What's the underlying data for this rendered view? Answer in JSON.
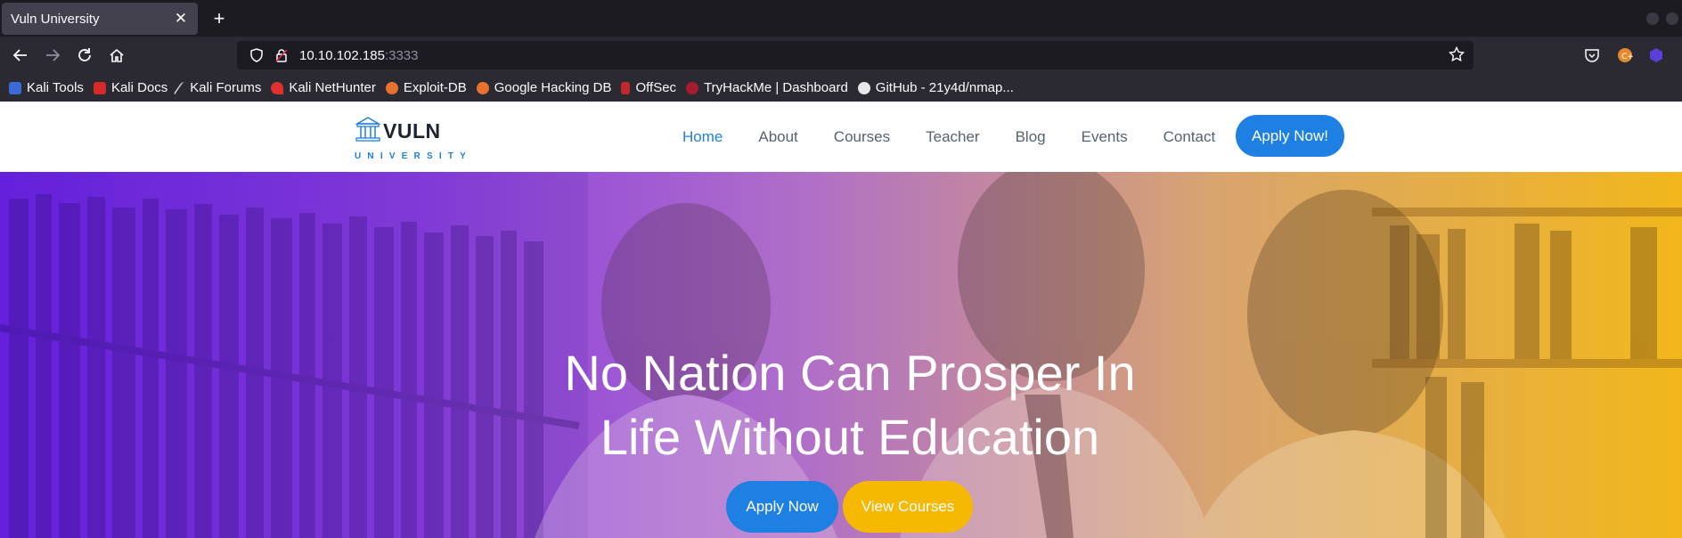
{
  "browser": {
    "tab": {
      "title": "Vuln University",
      "close_glyph": "✕"
    },
    "new_tab_glyph": "+",
    "url": {
      "host": "10.10.102.185",
      "port": ":3333"
    },
    "bookmarks": [
      {
        "label": "Kali Tools",
        "icon": "kali-tools-icon",
        "color": "#3b6bd6"
      },
      {
        "label": "Kali Docs",
        "icon": "kali-docs-icon",
        "color": "#d62b2b"
      },
      {
        "label": "Kali Forums",
        "icon": "kali-forums-icon",
        "color": "#cfcfcf"
      },
      {
        "label": "Kali NetHunter",
        "icon": "kali-nethunter-icon",
        "color": "#e03030"
      },
      {
        "label": "Exploit-DB",
        "icon": "exploit-db-icon",
        "color": "#e6722e"
      },
      {
        "label": "Google Hacking DB",
        "icon": "ghdb-icon",
        "color": "#e6722e"
      },
      {
        "label": "OffSec",
        "icon": "offsec-icon",
        "color": "#c0282d"
      },
      {
        "label": "TryHackMe | Dashboard",
        "icon": "tryhackme-icon",
        "color": "#a51d2d"
      },
      {
        "label": "GitHub - 21y4d/nmap...",
        "icon": "github-icon",
        "color": "#e8e8e8"
      }
    ]
  },
  "site": {
    "logo": {
      "word": "VULN",
      "sub": "UNIVERSITY"
    },
    "menu": [
      "Home",
      "About",
      "Courses",
      "Teacher",
      "Blog",
      "Events",
      "Contact"
    ],
    "active_menu": "Home",
    "apply_button": "Apply Now!",
    "hero": {
      "title_line1": "No Nation Can Prosper In",
      "title_line2": "Life Without Education",
      "primary_button": "Apply Now",
      "secondary_button": "View Courses"
    },
    "colors": {
      "accent": "#1f80e3",
      "secondary": "#f7b801",
      "gradient_start": "#6a22e6",
      "gradient_end": "#f2b71b"
    }
  }
}
